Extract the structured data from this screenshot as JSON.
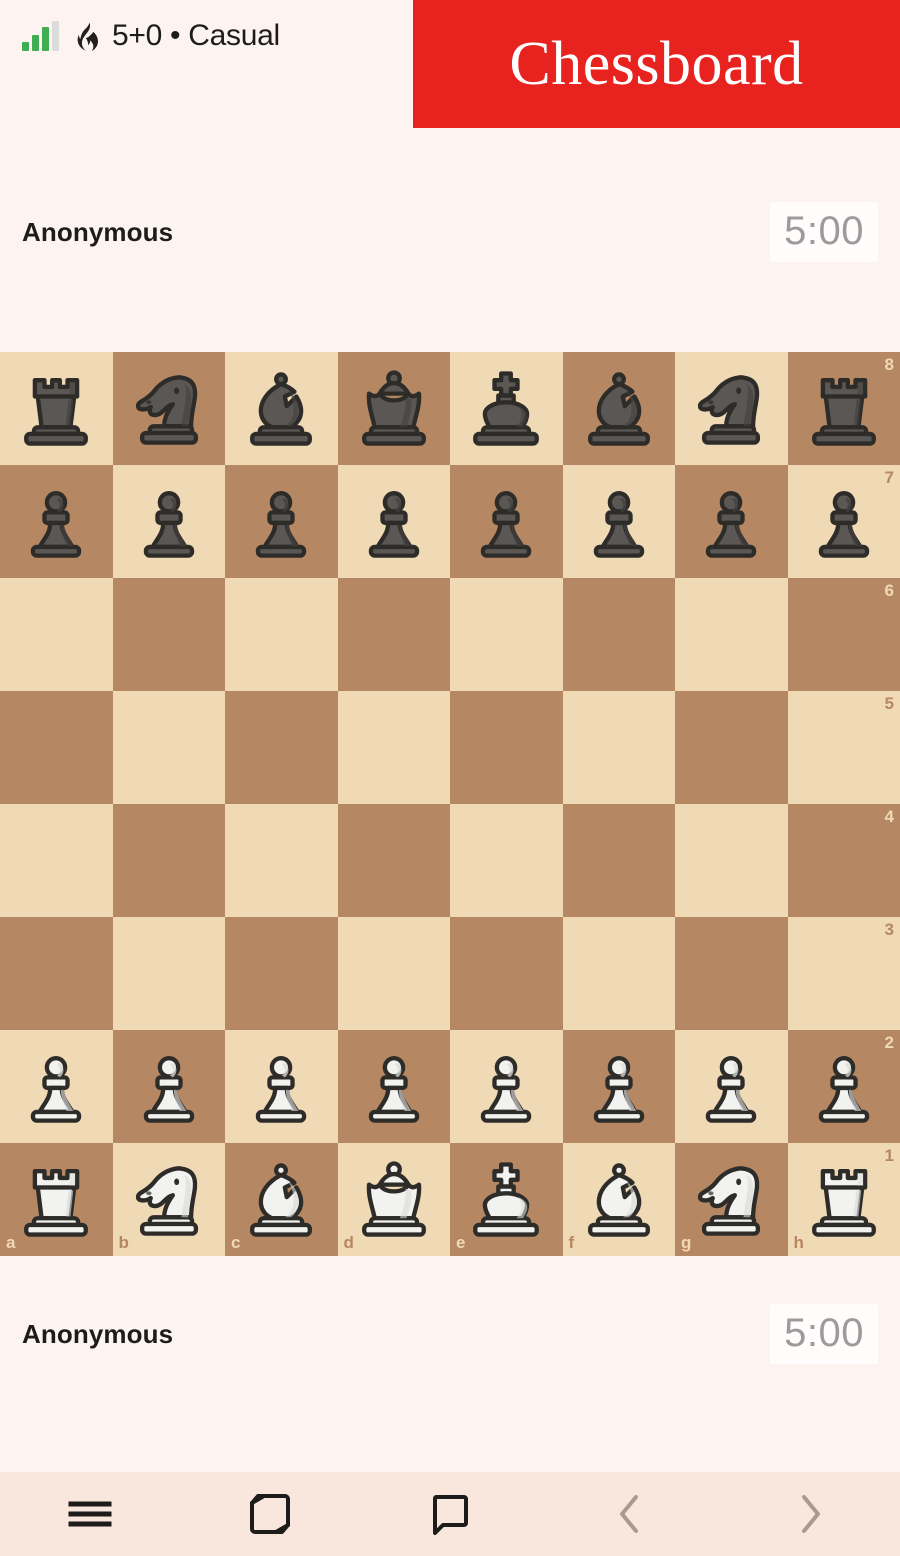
{
  "status_bar": {
    "signal_icon": "signal-bars-icon",
    "signal_bars_active": 3,
    "signal_bars_total": 4,
    "clock_icon": "flame-icon",
    "game_mode": "5+0 • Casual"
  },
  "banner": {
    "title": "Chessboard",
    "background_color": "#e8221f",
    "text_color": "#ffffff"
  },
  "players": {
    "top": {
      "name": "Anonymous",
      "clock": "5:00"
    },
    "bottom": {
      "name": "Anonymous",
      "clock": "5:00"
    }
  },
  "board": {
    "light_square_color": "#f0d9b5",
    "dark_square_color": "#b58863",
    "orientation": "white",
    "files": [
      "a",
      "b",
      "c",
      "d",
      "e",
      "f",
      "g",
      "h"
    ],
    "ranks": [
      "8",
      "7",
      "6",
      "5",
      "4",
      "3",
      "2",
      "1"
    ],
    "position_fen": "rnbqkbnr/pppppppp/8/8/8/8/PPPPPPPP/RNBQKBNR",
    "rows": [
      [
        "br",
        "bn",
        "bb",
        "bq",
        "bk",
        "bb",
        "bn",
        "br"
      ],
      [
        "bp",
        "bp",
        "bp",
        "bp",
        "bp",
        "bp",
        "bp",
        "bp"
      ],
      [
        "",
        "",
        "",
        "",
        "",
        "",
        "",
        ""
      ],
      [
        "",
        "",
        "",
        "",
        "",
        "",
        "",
        ""
      ],
      [
        "",
        "",
        "",
        "",
        "",
        "",
        "",
        ""
      ],
      [
        "",
        "",
        "",
        "",
        "",
        "",
        "",
        ""
      ],
      [
        "wp",
        "wp",
        "wp",
        "wp",
        "wp",
        "wp",
        "wp",
        "wp"
      ],
      [
        "wr",
        "wn",
        "wb",
        "wq",
        "wk",
        "wb",
        "wn",
        "wr"
      ]
    ],
    "piece_names": {
      "br": "black-rook",
      "bn": "black-knight",
      "bb": "black-bishop",
      "bq": "black-queen",
      "bk": "black-king",
      "bp": "black-pawn",
      "wr": "white-rook",
      "wn": "white-knight",
      "wb": "white-bishop",
      "wq": "white-queen",
      "wk": "white-king",
      "wp": "white-pawn"
    }
  },
  "bottom_nav": {
    "background_color": "#f9e6dc",
    "items": [
      {
        "name": "menu-button",
        "icon": "hamburger-menu-icon",
        "label": "Menu",
        "color": "#1d1c1a"
      },
      {
        "name": "flip-button",
        "icon": "flip-board-icon",
        "label": "Flip",
        "color": "#1d1c1a"
      },
      {
        "name": "chat-button",
        "icon": "chat-bubble-icon",
        "label": "Chat",
        "color": "#1d1c1a"
      },
      {
        "name": "prev-move-button",
        "icon": "chevron-left-icon",
        "label": "Previous",
        "color": "#a89a93"
      },
      {
        "name": "next-move-button",
        "icon": "chevron-right-icon",
        "label": "Next",
        "color": "#a89a93"
      }
    ]
  }
}
